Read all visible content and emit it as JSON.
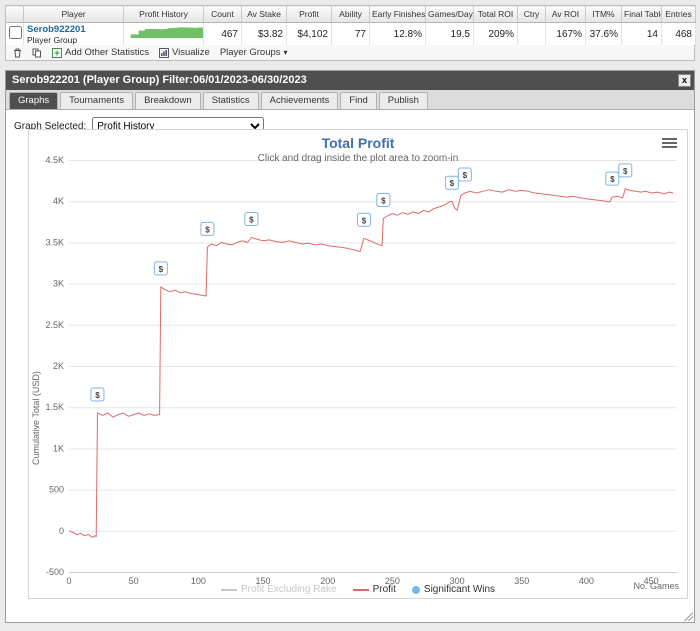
{
  "table": {
    "headers": [
      "",
      "Player",
      "Profit History",
      "Count",
      "Av Stake",
      "Profit",
      "Ability",
      "Early Finishes",
      "Games/Day",
      "Total ROI",
      "Ctry",
      "Av ROI",
      "ITM%",
      "Final Table:",
      "Entries"
    ],
    "row": {
      "player_name": "Serob922201",
      "player_sub": "Player Group",
      "count": "467",
      "av_stake": "$3.82",
      "profit": "$4,102",
      "ability": "77",
      "early_finishes": "12.8%",
      "games_day": "19.5",
      "total_roi": "209%",
      "ctry": "",
      "av_roi": "167%",
      "itm_pct": "37.6%",
      "final_table": "14",
      "entries": "468"
    }
  },
  "toolbar": {
    "add_other_statistics": "Add Other Statistics",
    "visualize": "Visualize",
    "player_groups": "Player Groups",
    "caret": "▾"
  },
  "panel": {
    "title": "Serob922201 (Player Group) Filter:06/01/2023-06/30/2023",
    "close": "x",
    "tabs": [
      "Graphs",
      "Tournaments",
      "Breakdown",
      "Statistics",
      "Achievements",
      "Find",
      "Publish"
    ],
    "graph_selected_label": "Graph Selected:",
    "graph_selected_value": "Profit History"
  },
  "chart_data": {
    "type": "line",
    "title": "Total Profit",
    "subtitle": "Click and drag inside the plot area to zoom-in",
    "xlabel": "No. Games",
    "ylabel": "Cumulative Total (USD)",
    "xlim": [
      0,
      470
    ],
    "ylim": [
      -500,
      4500
    ],
    "grid": "horizontal",
    "legend_position": "bottom",
    "x_ticks": [
      0,
      50,
      100,
      150,
      200,
      250,
      300,
      350,
      400,
      450
    ],
    "y_ticks": [
      4500,
      4000,
      3500,
      3000,
      2500,
      2000,
      1500,
      1000,
      500,
      0,
      -500
    ],
    "y_tick_labels": [
      "4.5K",
      "4K",
      "3.5K",
      "3K",
      "2.5K",
      "2K",
      "1.5K",
      "1K",
      "500",
      "0",
      "-500"
    ],
    "series": [
      {
        "name": "Profit Excluding Rake",
        "color": "#c6c6c6",
        "visible": false,
        "points": []
      },
      {
        "name": "Profit",
        "color": "#dd6b66",
        "visible": true,
        "points": [
          [
            0,
            0
          ],
          [
            3,
            -20
          ],
          [
            6,
            -45
          ],
          [
            9,
            -30
          ],
          [
            12,
            -60
          ],
          [
            15,
            -45
          ],
          [
            18,
            -80
          ],
          [
            20,
            -60
          ],
          [
            21,
            -70
          ],
          [
            22,
            1430
          ],
          [
            26,
            1400
          ],
          [
            30,
            1430
          ],
          [
            34,
            1380
          ],
          [
            38,
            1410
          ],
          [
            42,
            1430
          ],
          [
            46,
            1390
          ],
          [
            50,
            1410
          ],
          [
            54,
            1430
          ],
          [
            58,
            1400
          ],
          [
            62,
            1420
          ],
          [
            66,
            1400
          ],
          [
            70,
            1410
          ],
          [
            71,
            2960
          ],
          [
            74,
            2930
          ],
          [
            78,
            2900
          ],
          [
            82,
            2920
          ],
          [
            86,
            2890
          ],
          [
            90,
            2900
          ],
          [
            94,
            2880
          ],
          [
            98,
            2870
          ],
          [
            102,
            2860
          ],
          [
            106,
            2850
          ],
          [
            107,
            3440
          ],
          [
            110,
            3480
          ],
          [
            114,
            3460
          ],
          [
            118,
            3500
          ],
          [
            122,
            3480
          ],
          [
            126,
            3470
          ],
          [
            130,
            3500
          ],
          [
            134,
            3520
          ],
          [
            138,
            3500
          ],
          [
            141,
            3560
          ],
          [
            145,
            3540
          ],
          [
            150,
            3520
          ],
          [
            155,
            3530
          ],
          [
            160,
            3510
          ],
          [
            165,
            3500
          ],
          [
            170,
            3520
          ],
          [
            175,
            3500
          ],
          [
            180,
            3480
          ],
          [
            185,
            3490
          ],
          [
            190,
            3470
          ],
          [
            195,
            3480
          ],
          [
            200,
            3460
          ],
          [
            205,
            3450
          ],
          [
            210,
            3440
          ],
          [
            215,
            3430
          ],
          [
            220,
            3410
          ],
          [
            225,
            3390
          ],
          [
            228,
            3550
          ],
          [
            231,
            3530
          ],
          [
            234,
            3510
          ],
          [
            237,
            3490
          ],
          [
            240,
            3470
          ],
          [
            242,
            3460
          ],
          [
            243,
            3790
          ],
          [
            246,
            3820
          ],
          [
            250,
            3850
          ],
          [
            254,
            3830
          ],
          [
            258,
            3860
          ],
          [
            262,
            3840
          ],
          [
            266,
            3870
          ],
          [
            270,
            3850
          ],
          [
            274,
            3890
          ],
          [
            278,
            3870
          ],
          [
            282,
            3910
          ],
          [
            286,
            3930
          ],
          [
            290,
            3950
          ],
          [
            294,
            3990
          ],
          [
            296,
            4000
          ],
          [
            298,
            3920
          ],
          [
            300,
            3890
          ],
          [
            303,
            4070
          ],
          [
            306,
            4100
          ],
          [
            310,
            4120
          ],
          [
            315,
            4100
          ],
          [
            320,
            4120
          ],
          [
            325,
            4140
          ],
          [
            330,
            4120
          ],
          [
            335,
            4110
          ],
          [
            340,
            4140
          ],
          [
            345,
            4120
          ],
          [
            350,
            4130
          ],
          [
            355,
            4120
          ],
          [
            360,
            4100
          ],
          [
            365,
            4090
          ],
          [
            370,
            4080
          ],
          [
            375,
            4070
          ],
          [
            380,
            4060
          ],
          [
            385,
            4050
          ],
          [
            390,
            4060
          ],
          [
            395,
            4040
          ],
          [
            400,
            4030
          ],
          [
            405,
            4020
          ],
          [
            410,
            4010
          ],
          [
            415,
            4000
          ],
          [
            418,
            3990
          ],
          [
            420,
            4050
          ],
          [
            424,
            4060
          ],
          [
            428,
            4040
          ],
          [
            430,
            4150
          ],
          [
            434,
            4130
          ],
          [
            438,
            4120
          ],
          [
            442,
            4110
          ],
          [
            446,
            4120
          ],
          [
            450,
            4100
          ],
          [
            455,
            4110
          ],
          [
            460,
            4090
          ],
          [
            464,
            4110
          ],
          [
            467,
            4100
          ]
        ]
      }
    ],
    "significant_wins": {
      "name": "Significant Wins",
      "color": "#7cb5ec",
      "marker": "$",
      "points": [
        [
          22,
          1430
        ],
        [
          71,
          2960
        ],
        [
          107,
          3440
        ],
        [
          141,
          3560
        ],
        [
          228,
          3550
        ],
        [
          243,
          3790
        ],
        [
          296,
          4000
        ],
        [
          306,
          4100
        ],
        [
          420,
          4050
        ],
        [
          430,
          4150
        ]
      ]
    },
    "legend": [
      {
        "label": "Profit Excluding Rake",
        "type": "line",
        "color": "#c6c6c6",
        "muted": true
      },
      {
        "label": "Profit",
        "type": "line",
        "color": "#dd6b66",
        "muted": false
      },
      {
        "label": "Significant Wins",
        "type": "dot",
        "color": "#7cb5ec",
        "muted": false
      }
    ]
  }
}
